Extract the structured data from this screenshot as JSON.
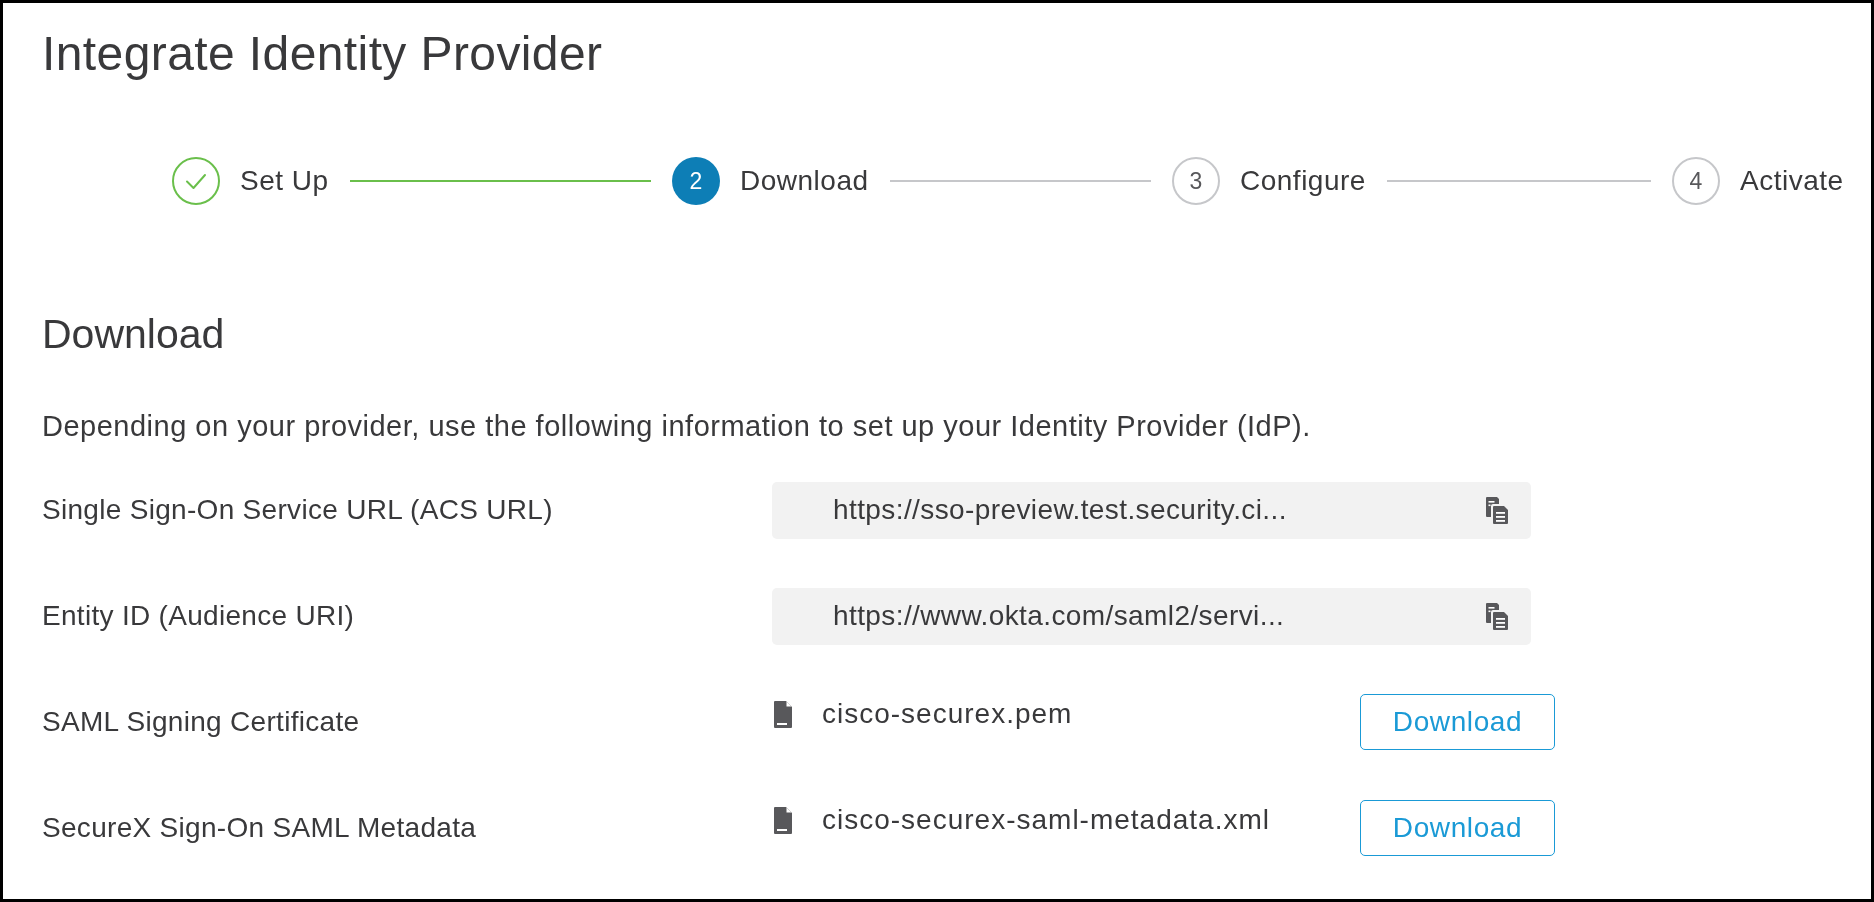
{
  "title": "Integrate Identity Provider",
  "steps": [
    {
      "label": "Set Up",
      "completed": true,
      "selected": false
    },
    {
      "number": "2",
      "label": "Download",
      "completed": false,
      "selected": true
    },
    {
      "number": "3",
      "label": "Configure",
      "completed": false,
      "selected": false
    },
    {
      "number": "4",
      "label": "Activate",
      "completed": false,
      "selected": false
    }
  ],
  "section": {
    "heading": "Download",
    "description": "Depending on your provider, use the following information to set up your Identity Provider (IdP).",
    "rows": [
      {
        "kind": "copy_field",
        "label": "Single Sign-On Service URL (ACS URL)",
        "value": "https://sso-preview.test.security.ci..."
      },
      {
        "kind": "copy_field",
        "label": "Entity ID (Audience URI)",
        "value": "https://www.okta.com/saml2/servi..."
      },
      {
        "kind": "file",
        "label": "SAML Signing Certificate",
        "file_name": "cisco-securex.pem",
        "button": "Download"
      },
      {
        "kind": "file",
        "label": "SecureX Sign-On SAML Metadata",
        "file_name": "cisco-securex-saml-metadata.xml",
        "button": "Download"
      }
    ]
  }
}
